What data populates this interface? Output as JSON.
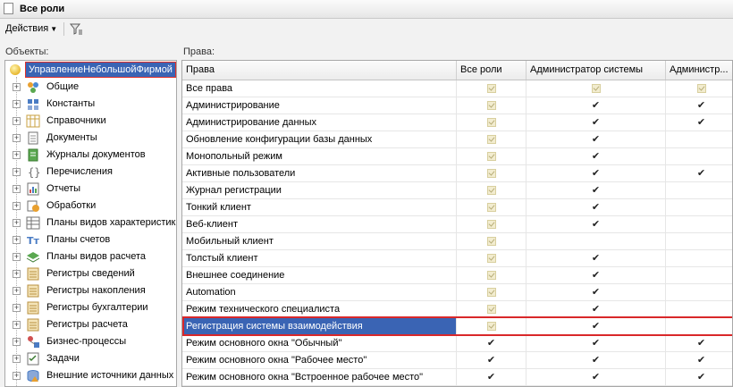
{
  "window": {
    "title": "Все роли"
  },
  "toolbar": {
    "actions_label": "Действия"
  },
  "panels": {
    "objects_label": "Объекты:",
    "rights_label": "Права:"
  },
  "tree": {
    "root": "УправлениеНебольшойФирмой",
    "items": [
      {
        "label": "Общие",
        "icon": "shapes-icon"
      },
      {
        "label": "Константы",
        "icon": "constants-icon"
      },
      {
        "label": "Справочники",
        "icon": "catalog-icon"
      },
      {
        "label": "Документы",
        "icon": "document-icon"
      },
      {
        "label": "Журналы документов",
        "icon": "journal-icon"
      },
      {
        "label": "Перечисления",
        "icon": "enum-icon"
      },
      {
        "label": "Отчеты",
        "icon": "report-icon"
      },
      {
        "label": "Обработки",
        "icon": "processing-icon"
      },
      {
        "label": "Планы видов характеристик",
        "icon": "plan-chars-icon"
      },
      {
        "label": "Планы счетов",
        "icon": "accounts-icon"
      },
      {
        "label": "Планы видов расчета",
        "icon": "calc-plan-icon"
      },
      {
        "label": "Регистры сведений",
        "icon": "register-icon"
      },
      {
        "label": "Регистры накопления",
        "icon": "register-icon"
      },
      {
        "label": "Регистры бухгалтерии",
        "icon": "register-icon"
      },
      {
        "label": "Регистры расчета",
        "icon": "register-icon"
      },
      {
        "label": "Бизнес-процессы",
        "icon": "business-process-icon"
      },
      {
        "label": "Задачи",
        "icon": "task-icon"
      },
      {
        "label": "Внешние источники данных",
        "icon": "external-source-icon"
      }
    ]
  },
  "grid": {
    "columns": [
      "Права",
      "Все роли",
      "Администратор системы",
      "Администр..."
    ],
    "rows": [
      {
        "name": "Все права",
        "c": [
          "g",
          "g",
          "g"
        ]
      },
      {
        "name": "Администрирование",
        "c": [
          "g",
          "v",
          "v"
        ]
      },
      {
        "name": "Администрирование данных",
        "c": [
          "g",
          "v",
          "v"
        ]
      },
      {
        "name": "Обновление конфигурации базы данных",
        "c": [
          "g",
          "v",
          ""
        ]
      },
      {
        "name": "Монопольный режим",
        "c": [
          "g",
          "v",
          ""
        ]
      },
      {
        "name": "Активные пользователи",
        "c": [
          "g",
          "v",
          "v"
        ]
      },
      {
        "name": "Журнал регистрации",
        "c": [
          "g",
          "v",
          ""
        ]
      },
      {
        "name": "Тонкий клиент",
        "c": [
          "g",
          "v",
          ""
        ]
      },
      {
        "name": "Веб-клиент",
        "c": [
          "g",
          "v",
          ""
        ]
      },
      {
        "name": "Мобильный клиент",
        "c": [
          "g",
          "",
          ""
        ]
      },
      {
        "name": "Толстый клиент",
        "c": [
          "g",
          "v",
          ""
        ]
      },
      {
        "name": "Внешнее соединение",
        "c": [
          "g",
          "v",
          ""
        ]
      },
      {
        "name": "Automation",
        "c": [
          "g",
          "v",
          ""
        ]
      },
      {
        "name": "Режим технического специалиста",
        "c": [
          "g",
          "v",
          ""
        ]
      },
      {
        "name": "Регистрация системы взаимодействия",
        "c": [
          "g",
          "v",
          ""
        ],
        "selected": true
      },
      {
        "name": "Режим основного окна \"Обычный\"",
        "c": [
          "v",
          "v",
          "v"
        ]
      },
      {
        "name": "Режим основного окна \"Рабочее место\"",
        "c": [
          "v",
          "v",
          "v"
        ]
      },
      {
        "name": "Режим основного окна \"Встроенное рабочее место\"",
        "c": [
          "v",
          "v",
          "v"
        ]
      }
    ]
  },
  "colors": {
    "selection": "#3a64b4",
    "highlight_border": "#d9282a"
  }
}
